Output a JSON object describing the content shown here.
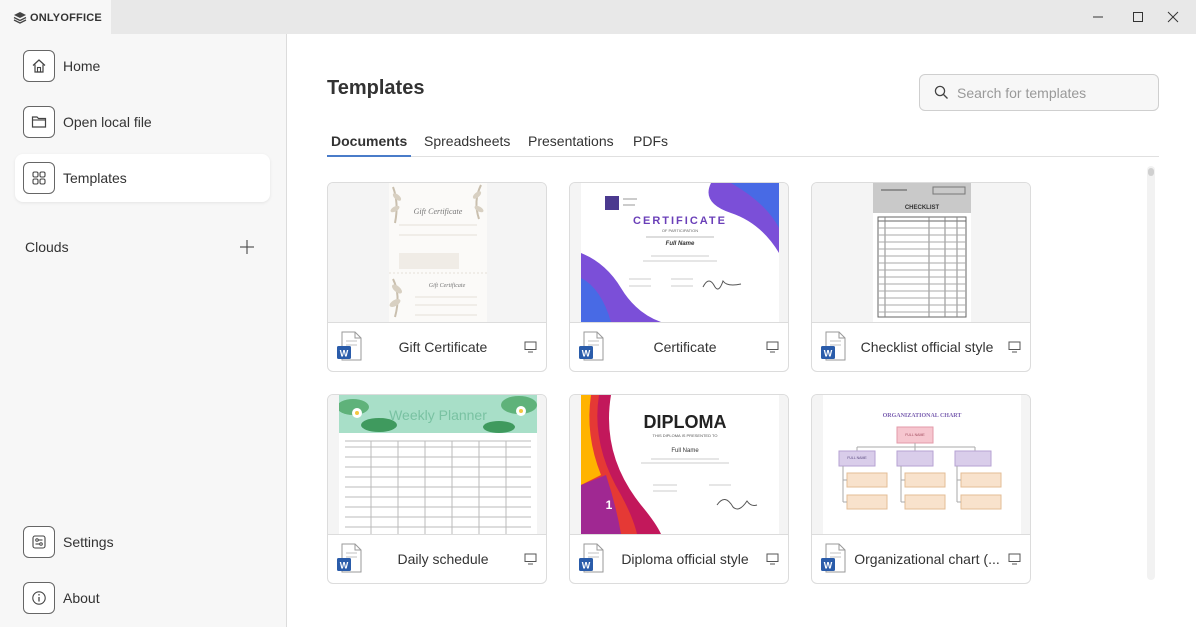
{
  "app": {
    "brand": "ONLYOFFICE",
    "window_controls": [
      "minimize-icon",
      "maximize-icon",
      "close-icon"
    ]
  },
  "sidebar": {
    "items": [
      {
        "label": "Home",
        "icon": "home-icon",
        "active": false
      },
      {
        "label": "Open local file",
        "icon": "folder-icon",
        "active": false
      },
      {
        "label": "Templates",
        "icon": "grid-icon",
        "active": true
      }
    ],
    "clouds_label": "Clouds",
    "bottom_items": [
      {
        "label": "Settings",
        "icon": "settings-icon"
      },
      {
        "label": "About",
        "icon": "info-icon"
      }
    ]
  },
  "main": {
    "title": "Templates",
    "search": {
      "placeholder": "Search for templates",
      "value": ""
    },
    "tabs": [
      {
        "label": "Documents",
        "active": true
      },
      {
        "label": "Spreadsheets",
        "active": false
      },
      {
        "label": "Presentations",
        "active": false
      },
      {
        "label": "PDFs",
        "active": false
      }
    ],
    "templates": [
      {
        "name": "Gift Certificate",
        "preview": {
          "heading": "Gift Certificate"
        }
      },
      {
        "name": "Certificate",
        "preview": {
          "heading": "CERTIFICATE",
          "sub": "OF PARTICIPATION",
          "fullname": "Full Name"
        }
      },
      {
        "name": "Checklist official style",
        "preview": {
          "heading": "CHECKLIST"
        }
      },
      {
        "name": "Daily schedule",
        "preview": {
          "heading": "Weekly Planner"
        }
      },
      {
        "name": "Diploma official style",
        "preview": {
          "heading": "DIPLOMA",
          "sub": "THIS DIPLOMA IS PRESENTED TO",
          "fullname": "Full Name"
        }
      },
      {
        "name": "Organizational chart (...",
        "preview": {
          "heading": "ORGANIZATIONAL CHART",
          "box_top": "FULL NAME",
          "box_mid": "FULL NAME"
        }
      }
    ]
  },
  "colors": {
    "accent": "#4a7cc9",
    "word_blue": "#2a5caa",
    "sidebar_bg": "#f7f7f7",
    "titlebar_bg": "#e8e8e8"
  }
}
